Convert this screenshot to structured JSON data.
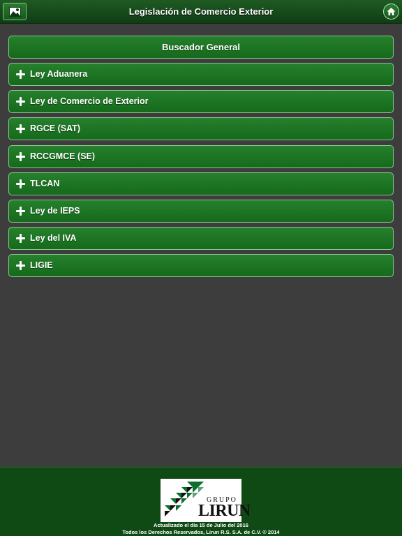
{
  "header": {
    "title": "Legislación de Comercio Exterior",
    "left_icon": "image-icon",
    "right_icon": "home-icon"
  },
  "search": {
    "label": "Buscador General"
  },
  "items": [
    {
      "label": "Ley Aduanera"
    },
    {
      "label": "Ley de Comercio de Exterior"
    },
    {
      "label": "RGCE (SAT)"
    },
    {
      "label": "RCCGMCE (SE)"
    },
    {
      "label": "TLCAN"
    },
    {
      "label": "Ley de IEPS"
    },
    {
      "label": "Ley del IVA"
    },
    {
      "label": "LIGIE"
    }
  ],
  "footer": {
    "logo_grupo": "GRUPO",
    "logo_name": "LIRUN",
    "updated": "Actualizado el día 15 de Julio del 2016",
    "rights": "Todos los Derechos Reservados, Lirun R.S. S.A. de C.V. © 2014"
  },
  "colors": {
    "accent": "#1f7a25",
    "background": "#3d3d3d",
    "footer": "#0f4a14"
  }
}
